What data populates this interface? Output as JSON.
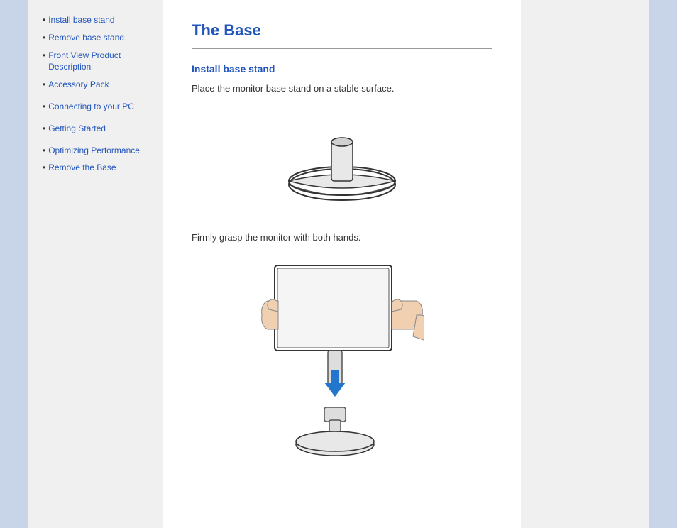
{
  "page": {
    "title": "The Base"
  },
  "sidebar": {
    "groups": [
      {
        "items": [
          {
            "label": "Install base stand",
            "href": "#install"
          },
          {
            "label": "Remove base stand",
            "href": "#remove"
          },
          {
            "label": "Front View Product Description",
            "href": "#front"
          },
          {
            "label": "Accessory Pack",
            "href": "#accessory"
          }
        ]
      },
      {
        "items": [
          {
            "label": "Connecting to your PC",
            "href": "#connecting"
          }
        ]
      },
      {
        "items": [
          {
            "label": "Getting Started",
            "href": "#getting"
          }
        ]
      },
      {
        "items": [
          {
            "label": "Optimizing Performance",
            "href": "#optimizing"
          },
          {
            "label": "Remove the Base",
            "href": "#removebase"
          }
        ]
      }
    ]
  },
  "main": {
    "section1": {
      "heading": "Install base stand",
      "text1": "Place the monitor base stand on a stable surface.",
      "text2": "Firmly grasp the monitor with both hands."
    }
  },
  "colors": {
    "accent": "#2255bb",
    "sidebar_bg": "#f0f0f0",
    "border_accent": "#c8d4e8"
  }
}
